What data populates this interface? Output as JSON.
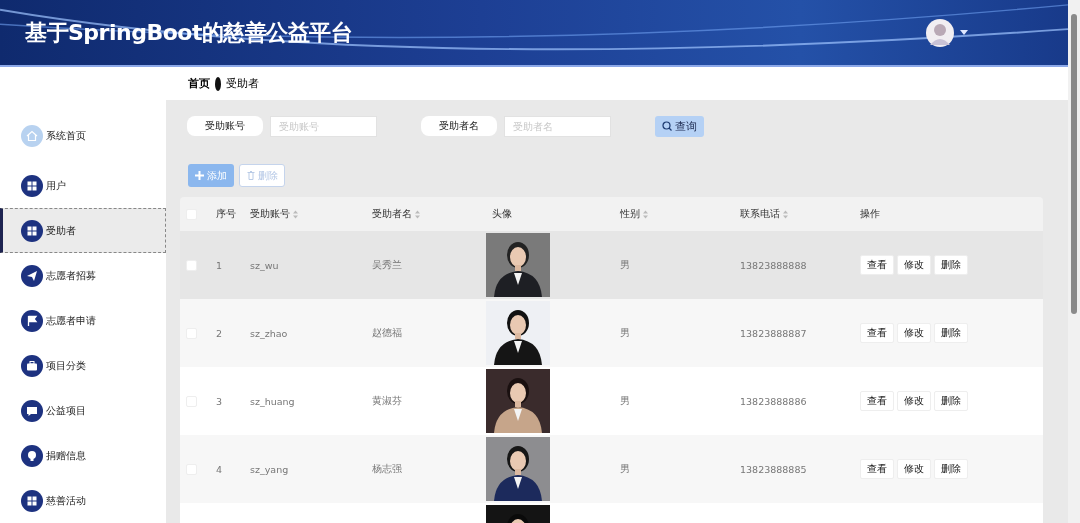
{
  "header": {
    "title": "基于SpringBoot的慈善公益平台"
  },
  "sidebar": {
    "items": [
      {
        "label": "系统首页",
        "kind": "home",
        "selected": false
      },
      {
        "label": "用户",
        "kind": "grid",
        "selected": false
      },
      {
        "label": "受助者",
        "kind": "grid",
        "selected": true
      },
      {
        "label": "志愿者招募",
        "kind": "plane",
        "selected": false
      },
      {
        "label": "志愿者申请",
        "kind": "flag",
        "selected": false
      },
      {
        "label": "项目分类",
        "kind": "briefcase",
        "selected": false
      },
      {
        "label": "公益项目",
        "kind": "chat",
        "selected": false
      },
      {
        "label": "捐赠信息",
        "kind": "bulb",
        "selected": false
      },
      {
        "label": "慈善活动",
        "kind": "grid",
        "selected": false
      }
    ]
  },
  "breadcrumb": [
    "首页",
    "受助者"
  ],
  "search": {
    "fields": [
      {
        "label": "受助账号",
        "placeholder": "受助账号"
      },
      {
        "label": "受助者名",
        "placeholder": "受助者名"
      }
    ],
    "button": "查询"
  },
  "toolbar": {
    "add": "添加",
    "delete": "删除"
  },
  "table": {
    "header_checked": false,
    "columns": [
      {
        "label": "序号",
        "sortable": false
      },
      {
        "label": "受助账号",
        "sortable": true
      },
      {
        "label": "受助者名",
        "sortable": true
      },
      {
        "label": "头像",
        "sortable": false
      },
      {
        "label": "性别",
        "sortable": true
      },
      {
        "label": "联系电话",
        "sortable": true
      },
      {
        "label": "操作",
        "sortable": false
      }
    ],
    "rows": [
      {
        "checked": false,
        "highlighted": true,
        "index": "1",
        "account": "sz_wu",
        "name": "吴秀兰",
        "photo": {
          "kind": "picture"
        },
        "gender": "男",
        "phone": "13823888888",
        "actions": [
          "查看",
          "修改",
          "删除"
        ]
      },
      {
        "checked": false,
        "highlighted": false,
        "index": "2",
        "account": "sz_zhao",
        "name": "赵德福",
        "photo": {
          "kind": "picture"
        },
        "gender": "男",
        "phone": "13823888887",
        "actions": [
          "查看",
          "修改",
          "删除"
        ]
      },
      {
        "checked": false,
        "highlighted": false,
        "index": "3",
        "account": "sz_huang",
        "name": "黄淑芬",
        "photo": {
          "kind": "picture"
        },
        "gender": "男",
        "phone": "13823888886",
        "actions": [
          "查看",
          "修改",
          "删除"
        ]
      },
      {
        "checked": false,
        "highlighted": false,
        "index": "4",
        "account": "sz_yang",
        "name": "杨志强",
        "photo": {
          "kind": "picture"
        },
        "gender": "男",
        "phone": "13823888885",
        "actions": [
          "查看",
          "修改",
          "删除"
        ]
      },
      {
        "photo": {
          "kind": "picture"
        }
      }
    ]
  }
}
